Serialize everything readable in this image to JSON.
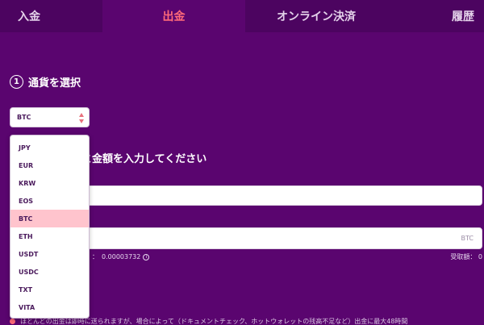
{
  "tabs": [
    "入金",
    "出金",
    "オンライン決済",
    "履歴"
  ],
  "step1": {
    "number": "1",
    "title": "通貨を選択"
  },
  "currency_select": {
    "selected": "BTC"
  },
  "step2": {
    "title_visible": "スと金額を入力してください"
  },
  "amount_field": {
    "unit": "BTC"
  },
  "fee": {
    "label_visible": "：",
    "value": "0.00003732"
  },
  "received": {
    "label": "受取額：",
    "value": "0"
  },
  "notice": {
    "text_visible": "ほとんどの出金は即時に送られますが、場合によって（ドキュメントチェック、ホットウォレットの残高不足など）出金に最大48時間"
  },
  "dropdown": {
    "options": [
      "JPY",
      "EUR",
      "KRW",
      "EOS",
      "BTC",
      "ETH",
      "USDT",
      "USDC",
      "TXT",
      "VITA"
    ],
    "highlighted": "BTC"
  },
  "colors": {
    "background": "#5a056f",
    "tab_inactive": "#4c0460",
    "accent": "#ff6a79",
    "highlight": "#ffc4cd"
  }
}
